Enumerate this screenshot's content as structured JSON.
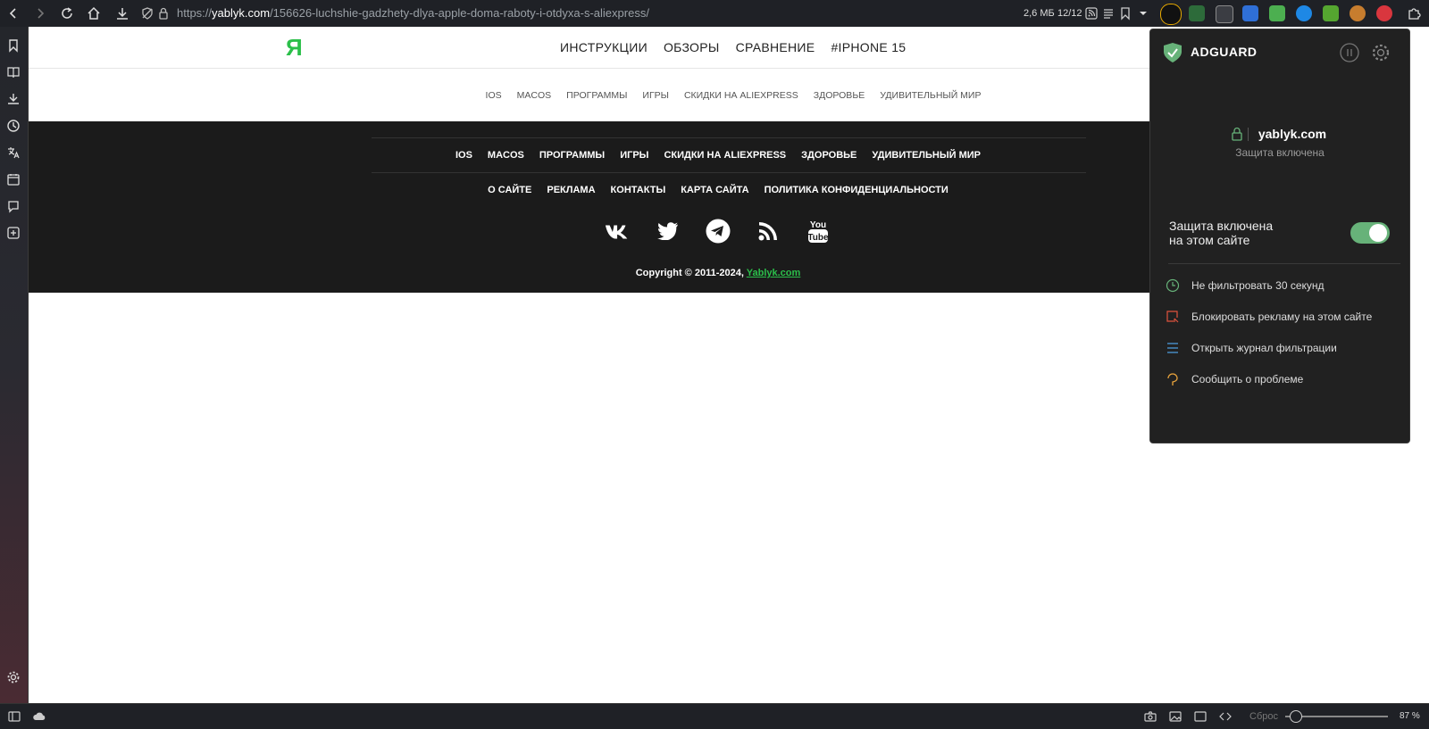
{
  "browser": {
    "url_prefix": "https://",
    "url_host": "yablyk.com",
    "url_path": "/156626-luchshie-gadzhety-dlya-apple-doma-raboty-i-otdyxa-s-aliexpress/",
    "memory": "2,6 МБ",
    "tab_count": "12/12",
    "zoom": "87 %",
    "reset_label": "Сброс",
    "zoom_level": 0.1
  },
  "site": {
    "logo": "Я",
    "main_nav": [
      "ИНСТРУКЦИИ",
      "ОБЗОРЫ",
      "СРАВНЕНИЕ",
      "#IPHONE 15"
    ],
    "sub_nav": [
      "IOS",
      "MACOS",
      "ПРОГРАММЫ",
      "ИГРЫ",
      "СКИДКИ НА ALIEXPRESS",
      "ЗДОРОВЬЕ",
      "УДИВИТЕЛЬНЫЙ МИР"
    ],
    "footer_cats": [
      "IOS",
      "MACOS",
      "ПРОГРАММЫ",
      "ИГРЫ",
      "СКИДКИ НА ALIEXPRESS",
      "ЗДОРОВЬЕ",
      "УДИВИТЕЛЬНЫЙ МИР"
    ],
    "footer_links": [
      "О САЙТЕ",
      "РЕКЛАМА",
      "КОНТАКТЫ",
      "КАРТА САЙТА",
      "ПОЛИТИКА КОНФИДЕНЦИАЛЬНОСТИ"
    ],
    "social": [
      "vk-icon",
      "twitter-icon",
      "telegram-icon",
      "rss-icon",
      "youtube-icon"
    ],
    "copyright_text": "Copyright © 2011-2024, ",
    "copyright_link": "Yablyk.com",
    "accent": "#2bbf4a"
  },
  "adguard": {
    "brand": "ADGUARD",
    "domain": "yablyk.com",
    "status": "Защита включена",
    "protect_line1": "Защита включена",
    "protect_line2": "на этом сайте",
    "toggle_on": true,
    "actions": [
      {
        "label": "Не фильтровать 30 секунд",
        "icon": "clock-icon",
        "color": "#67b279"
      },
      {
        "label": "Блокировать рекламу на этом сайте",
        "icon": "block-ad-icon",
        "color": "#e0533d"
      },
      {
        "label": "Открыть журнал фильтрации",
        "icon": "list-icon",
        "color": "#4d9ee0"
      },
      {
        "label": "Сообщить о проблеме",
        "icon": "report-icon",
        "color": "#e8a33d"
      }
    ]
  }
}
